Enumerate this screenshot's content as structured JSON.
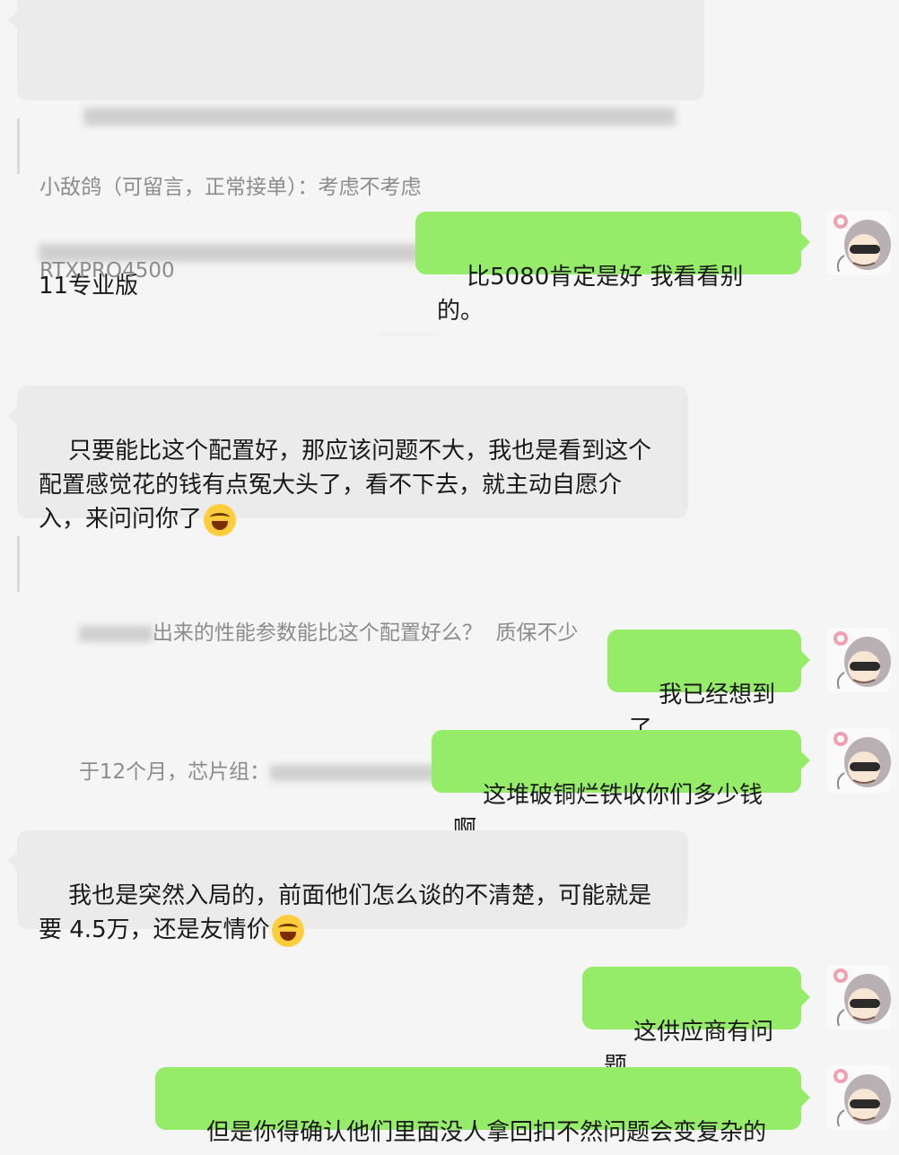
{
  "messages": [
    {
      "id": "m0",
      "side": "in",
      "line3": "11专业版"
    },
    {
      "id": "q0",
      "type": "quote",
      "line1": "小敌鸽（可留言，正常接单）：考虑不考虑",
      "line2": "RTXPRO4500"
    },
    {
      "id": "m1",
      "side": "out",
      "text": "比5080肯定是好 我看看别的。"
    },
    {
      "id": "m2",
      "side": "in",
      "text": "只要能比这个配置好，那应该问题不大，我也是看到这个\n配置感觉花的钱有点冤大头了，看不下去，就主动自愿介\n入，来问问你了"
    },
    {
      "id": "q1",
      "type": "quote",
      "line1_visible": "出来的性能参数能比这个配置好么？  质保不少",
      "line2_visible": "于12个月，芯片组："
    },
    {
      "id": "m3",
      "side": "out",
      "text": "我已经想到了"
    },
    {
      "id": "m4",
      "side": "out",
      "text": "这堆破铜烂铁收你们多少钱啊"
    },
    {
      "id": "m5",
      "side": "in",
      "text": "我也是突然入局的，前面他们怎么谈的不清楚，可能就是\n要 4.5万，还是友情价"
    },
    {
      "id": "m6",
      "side": "out",
      "text": "这供应商有问题"
    },
    {
      "id": "m7",
      "side": "out",
      "text": "但是你得确认他们里面没人拿回扣不然问题会变复杂的"
    }
  ],
  "emoji": {
    "name": "laughing-tears-emoji"
  },
  "avatar": {
    "name": "user-avatar"
  },
  "colors": {
    "background": "#f5f5f5",
    "incoming_bubble": "#ebebeb",
    "outgoing_bubble": "#95ec69",
    "quote_text": "#8c8c8c"
  }
}
